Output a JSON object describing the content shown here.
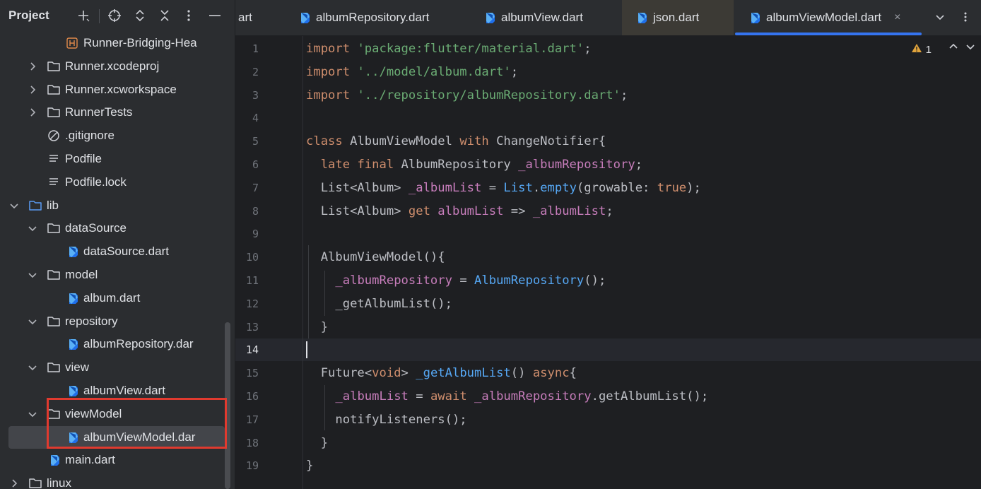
{
  "sidebar": {
    "title": "Project",
    "tools": [
      "add-icon",
      "locate-icon",
      "expand-collapse-icon",
      "collapse-all-icon",
      "more-icon",
      "hide-icon"
    ],
    "tree": [
      {
        "label": "Runner-Bridging-Hea",
        "type": "header-file",
        "depth": 3,
        "expanded": null
      },
      {
        "label": "Runner.xcodeproj",
        "type": "folder",
        "depth": 2,
        "expanded": false
      },
      {
        "label": "Runner.xcworkspace",
        "type": "folder",
        "depth": 2,
        "expanded": false
      },
      {
        "label": "RunnerTests",
        "type": "folder",
        "depth": 2,
        "expanded": false
      },
      {
        "label": ".gitignore",
        "type": "ignore-file",
        "depth": 2,
        "expanded": null
      },
      {
        "label": "Podfile",
        "type": "text-file",
        "depth": 2,
        "expanded": null
      },
      {
        "label": "Podfile.lock",
        "type": "text-file",
        "depth": 2,
        "expanded": null
      },
      {
        "label": "lib",
        "type": "source-folder",
        "depth": 1,
        "expanded": true
      },
      {
        "label": "dataSource",
        "type": "folder",
        "depth": 2,
        "expanded": true
      },
      {
        "label": "dataSource.dart",
        "type": "dart-file",
        "depth": 3,
        "expanded": null
      },
      {
        "label": "model",
        "type": "folder",
        "depth": 2,
        "expanded": true
      },
      {
        "label": "album.dart",
        "type": "dart-file",
        "depth": 3,
        "expanded": null
      },
      {
        "label": "repository",
        "type": "folder",
        "depth": 2,
        "expanded": true
      },
      {
        "label": "albumRepository.dar",
        "type": "dart-file",
        "depth": 3,
        "expanded": null
      },
      {
        "label": "view",
        "type": "folder",
        "depth": 2,
        "expanded": true
      },
      {
        "label": "albumView.dart",
        "type": "dart-file",
        "depth": 3,
        "expanded": null
      },
      {
        "label": "viewModel",
        "type": "folder",
        "depth": 2,
        "expanded": true
      },
      {
        "label": "albumViewModel.dar",
        "type": "dart-file",
        "depth": 3,
        "expanded": null,
        "selected": true
      },
      {
        "label": "main.dart",
        "type": "dart-file",
        "depth": 2,
        "expanded": null
      },
      {
        "label": "linux",
        "type": "folder",
        "depth": 1,
        "expanded": false
      }
    ]
  },
  "tabs": [
    {
      "label": "art",
      "icon": "none",
      "active": false
    },
    {
      "label": "albumRepository.dart",
      "icon": "dart-file-icon",
      "active": false
    },
    {
      "label": "albumView.dart",
      "icon": "dart-file-icon",
      "active": false
    },
    {
      "label": "json.dart",
      "icon": "dart-file-icon",
      "active": false,
      "hovered": true
    },
    {
      "label": "albumViewModel.dart",
      "icon": "dart-file-icon",
      "active": true,
      "close": "×"
    }
  ],
  "editor": {
    "warning_count": "1",
    "current_line": 14,
    "lines": [
      [
        [
          "k",
          "import "
        ],
        [
          "s",
          "'package:flutter/material.dart'"
        ],
        [
          "t",
          ";"
        ]
      ],
      [
        [
          "k",
          "import "
        ],
        [
          "s",
          "'../model/album.dart'"
        ],
        [
          "t",
          ";"
        ]
      ],
      [
        [
          "k",
          "import "
        ],
        [
          "s",
          "'../repository/albumRepository.dart'"
        ],
        [
          "t",
          ";"
        ]
      ],
      [],
      [
        [
          "k",
          "class "
        ],
        [
          "t",
          "AlbumViewModel "
        ],
        [
          "k",
          "with "
        ],
        [
          "t",
          "ChangeNotifier{"
        ]
      ],
      [
        [
          "t",
          "  "
        ],
        [
          "k",
          "late final "
        ],
        [
          "t",
          "AlbumRepository "
        ],
        [
          "f",
          "_albumRepository"
        ],
        [
          "t",
          ";"
        ]
      ],
      [
        [
          "t",
          "  List<Album> "
        ],
        [
          "f",
          "_albumList"
        ],
        [
          "t",
          " = "
        ],
        [
          "m",
          "List"
        ],
        [
          "t",
          "."
        ],
        [
          "m",
          "empty"
        ],
        [
          "t",
          "(growable: "
        ],
        [
          "k",
          "true"
        ],
        [
          "t",
          ");"
        ]
      ],
      [
        [
          "t",
          "  List<Album> "
        ],
        [
          "k",
          "get "
        ],
        [
          "f",
          "albumList"
        ],
        [
          "t",
          " => "
        ],
        [
          "f",
          "_albumList"
        ],
        [
          "t",
          ";"
        ]
      ],
      [],
      [
        [
          "t",
          "  AlbumViewModel(){"
        ]
      ],
      [
        [
          "t",
          "    "
        ],
        [
          "f",
          "_albumRepository"
        ],
        [
          "t",
          " = "
        ],
        [
          "m",
          "AlbumRepository"
        ],
        [
          "t",
          "();"
        ]
      ],
      [
        [
          "t",
          "    _getAlbumList();"
        ]
      ],
      [
        [
          "t",
          "  }"
        ]
      ],
      [],
      [
        [
          "t",
          "  Future<"
        ],
        [
          "k",
          "void"
        ],
        [
          "t",
          "> "
        ],
        [
          "m",
          "_getAlbumList"
        ],
        [
          "t",
          "() "
        ],
        [
          "k",
          "async"
        ],
        [
          "t",
          "{"
        ]
      ],
      [
        [
          "t",
          "    "
        ],
        [
          "f",
          "_albumList"
        ],
        [
          "t",
          " = "
        ],
        [
          "k",
          "await "
        ],
        [
          "f",
          "_albumRepository"
        ],
        [
          "t",
          ".getAlbumList();"
        ]
      ],
      [
        [
          "t",
          "    notifyListeners();"
        ]
      ],
      [
        [
          "t",
          "  }"
        ]
      ],
      [
        [
          "t",
          "}"
        ]
      ]
    ]
  },
  "colors": {
    "keyword": "#cf8e6d",
    "string": "#6aab73",
    "field": "#c77dbb",
    "method": "#56a8f5",
    "selection_outline": "#e03a2f",
    "active_tab_underline": "#3574f0"
  }
}
